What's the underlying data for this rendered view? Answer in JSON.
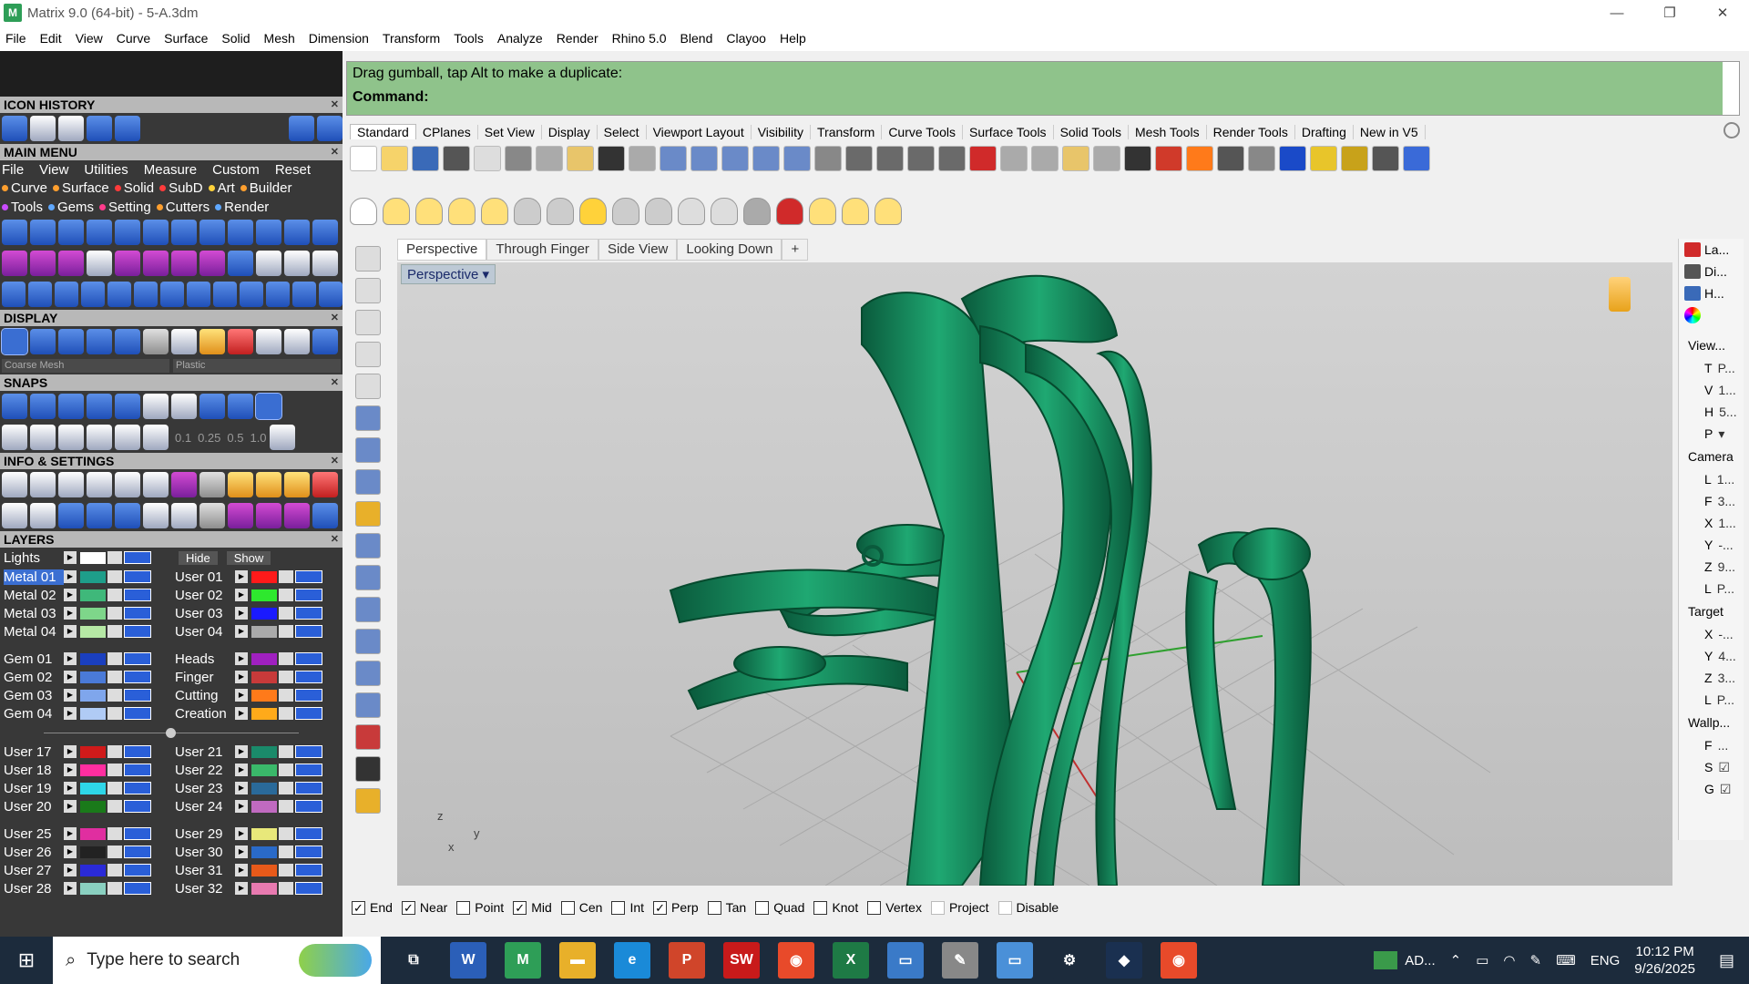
{
  "window": {
    "title": "Matrix 9.0 (64-bit) - 5-A.3dm",
    "logo": "M",
    "minimize": "—",
    "restore": "❐",
    "close": "✕"
  },
  "menu": [
    "File",
    "Edit",
    "View",
    "Curve",
    "Surface",
    "Solid",
    "Mesh",
    "Dimension",
    "Transform",
    "Tools",
    "Analyze",
    "Render",
    "Rhino 5.0",
    "Blend",
    "Clayoo",
    "Help"
  ],
  "left": {
    "icon_history": "ICON HISTORY",
    "main_menu": "MAIN MENU",
    "mm_items": [
      "File",
      "View",
      "Utilities",
      "Measure",
      "Custom",
      "Reset"
    ],
    "mm_cats": [
      {
        "label": "Curve",
        "color": "#ff9f2e"
      },
      {
        "label": "Surface",
        "color": "#ff9f2e"
      },
      {
        "label": "Solid",
        "color": "#ff3b3b"
      },
      {
        "label": "SubD",
        "color": "#ff3b3b"
      },
      {
        "label": "Art",
        "color": "#ffd23a"
      },
      {
        "label": "Builder",
        "color": "#ff9f2e"
      },
      {
        "label": "Tools",
        "color": "#c94bff"
      },
      {
        "label": "Gems",
        "color": "#5fa8ff"
      },
      {
        "label": "Setting",
        "color": "#ff3b8c"
      },
      {
        "label": "Cutters",
        "color": "#ff9f2e"
      },
      {
        "label": "Render",
        "color": "#5fa8ff"
      }
    ],
    "display": "DISPLAY",
    "display_mesh": "Coarse Mesh",
    "display_material": "Plastic",
    "snaps": "SNAPS",
    "snap_values": [
      "0.1",
      "0.25",
      "0.5",
      "1.0"
    ],
    "info_settings": "INFO & SETTINGS",
    "layers": "LAYERS",
    "lights": "Lights",
    "hide": "Hide",
    "show": "Show",
    "layers_left_1": [
      {
        "name": "Metal 01",
        "color": "#1e9e8a",
        "sel": true
      },
      {
        "name": "Metal 02",
        "color": "#3fb87a"
      },
      {
        "name": "Metal 03",
        "color": "#7ed68a"
      },
      {
        "name": "Metal 04",
        "color": "#b6e8a5"
      }
    ],
    "layers_right_1": [
      {
        "name": "User 01",
        "color": "#ff1a1a"
      },
      {
        "name": "User 02",
        "color": "#2ee82e"
      },
      {
        "name": "User 03",
        "color": "#1a1aff"
      },
      {
        "name": "User 04",
        "color": "#aaaaaa"
      }
    ],
    "layers_left_2": [
      {
        "name": "Gem 01",
        "color": "#1a3fbf"
      },
      {
        "name": "Gem 02",
        "color": "#4a7ad8"
      },
      {
        "name": "Gem 03",
        "color": "#7fa6ec"
      },
      {
        "name": "Gem 04",
        "color": "#b0cbf5"
      }
    ],
    "layers_right_2": [
      {
        "name": "Heads",
        "color": "#a020c0"
      },
      {
        "name": "Finger",
        "color": "#c83a3a"
      },
      {
        "name": "Cutting",
        "color": "#ff7a1a"
      },
      {
        "name": "Creation",
        "color": "#ffaa1a"
      }
    ],
    "layers_left_3": [
      {
        "name": "User 17",
        "color": "#d01a1a"
      },
      {
        "name": "User 18",
        "color": "#ff2ea0"
      },
      {
        "name": "User 19",
        "color": "#2ed6e8"
      },
      {
        "name": "User 20",
        "color": "#1a7a1a"
      }
    ],
    "layers_right_3": [
      {
        "name": "User 21",
        "color": "#1a8a6a"
      },
      {
        "name": "User 22",
        "color": "#3ab86a"
      },
      {
        "name": "User 23",
        "color": "#2a6a9a"
      },
      {
        "name": "User 24",
        "color": "#c06ac0"
      }
    ],
    "layers_left_4": [
      {
        "name": "User 25",
        "color": "#e02ea0"
      },
      {
        "name": "User 26",
        "color": "#222222"
      },
      {
        "name": "User 27",
        "color": "#2a2ad8"
      },
      {
        "name": "User 28",
        "color": "#8ad0c0"
      }
    ],
    "layers_right_4": [
      {
        "name": "User 29",
        "color": "#e8e87a"
      },
      {
        "name": "User 30",
        "color": "#2a6ac8"
      },
      {
        "name": "User 31",
        "color": "#e85a1a"
      },
      {
        "name": "User 32",
        "color": "#e87ab0"
      }
    ]
  },
  "command": {
    "prompt": "Drag gumball, tap Alt to make a duplicate:",
    "label": "Command:"
  },
  "toolbar_tabs": [
    "Standard",
    "CPlanes",
    "Set View",
    "Display",
    "Select",
    "Viewport Layout",
    "Visibility",
    "Transform",
    "Curve Tools",
    "Surface Tools",
    "Solid Tools",
    "Mesh Tools",
    "Render Tools",
    "Drafting",
    "New in V5"
  ],
  "viewport_tabs": [
    "Perspective",
    "Through Finger",
    "Side View",
    "Looking Down"
  ],
  "viewport_add": "+",
  "viewport_label": "Perspective",
  "viewport_dropdown": "▾",
  "axis": {
    "z": "z",
    "y": "y",
    "x": "x"
  },
  "right_panel": {
    "tabs": [
      "La...",
      "Di...",
      "H..."
    ],
    "view": "View...",
    "view_rows": [
      {
        "k": "T",
        "v": "P..."
      },
      {
        "k": "V",
        "v": "1..."
      },
      {
        "k": "H",
        "v": "5..."
      },
      {
        "k": "P",
        "v": "▾"
      }
    ],
    "camera": "Camera",
    "camera_rows": [
      {
        "k": "L",
        "v": "1..."
      },
      {
        "k": "F",
        "v": "3..."
      },
      {
        "k": "X",
        "v": "1..."
      },
      {
        "k": "Y",
        "v": "-..."
      },
      {
        "k": "Z",
        "v": "9..."
      },
      {
        "k": "L",
        "v": "P..."
      }
    ],
    "target": "Target",
    "target_rows": [
      {
        "k": "X",
        "v": "-..."
      },
      {
        "k": "Y",
        "v": "4..."
      },
      {
        "k": "Z",
        "v": "3..."
      },
      {
        "k": "L",
        "v": "P..."
      }
    ],
    "wallpaper": "Wallp...",
    "wall_rows": [
      {
        "k": "F",
        "v": "..."
      },
      {
        "k": "S",
        "v": "☑"
      },
      {
        "k": "G",
        "v": "☑"
      }
    ]
  },
  "osnaps": [
    {
      "label": "End",
      "checked": true
    },
    {
      "label": "Near",
      "checked": true
    },
    {
      "label": "Point",
      "checked": false
    },
    {
      "label": "Mid",
      "checked": true
    },
    {
      "label": "Cen",
      "checked": false
    },
    {
      "label": "Int",
      "checked": false
    },
    {
      "label": "Perp",
      "checked": true
    },
    {
      "label": "Tan",
      "checked": false
    },
    {
      "label": "Quad",
      "checked": false
    },
    {
      "label": "Knot",
      "checked": false
    },
    {
      "label": "Vertex",
      "checked": false
    },
    {
      "label": "Project",
      "checked": false,
      "disabled": true
    },
    {
      "label": "Disable",
      "checked": false,
      "disabled": true
    }
  ],
  "taskbar": {
    "search_placeholder": "Type here to search",
    "apps": [
      {
        "name": "task-view",
        "glyph": "⧉",
        "color": "#1c2b3c"
      },
      {
        "name": "word",
        "glyph": "W",
        "color": "#2b5fb8"
      },
      {
        "name": "matrix",
        "glyph": "M",
        "color": "#2e9e57"
      },
      {
        "name": "file-explorer",
        "glyph": "▬",
        "color": "#e8b02a"
      },
      {
        "name": "edge",
        "glyph": "e",
        "color": "#1a8ad8"
      },
      {
        "name": "powerpoint",
        "glyph": "P",
        "color": "#d0452a"
      },
      {
        "name": "solidworks",
        "glyph": "SW",
        "color": "#c81a1a"
      },
      {
        "name": "chrome",
        "glyph": "◉",
        "color": "#e84a2a"
      },
      {
        "name": "excel",
        "glyph": "X",
        "color": "#1e7a45"
      },
      {
        "name": "remote-desktop",
        "glyph": "▭",
        "color": "#3a7ac8"
      },
      {
        "name": "tools",
        "glyph": "✎",
        "color": "#888888"
      },
      {
        "name": "monitor",
        "glyph": "▭",
        "color": "#4a90d8"
      },
      {
        "name": "settings",
        "glyph": "⚙",
        "color": "#1c2b3c"
      },
      {
        "name": "app-dark",
        "glyph": "◆",
        "color": "#1a3050"
      },
      {
        "name": "chrome-2",
        "glyph": "◉",
        "color": "#e84a2a"
      }
    ],
    "tray_app": "AD...",
    "lang": "ENG",
    "time": "10:12 PM",
    "date": "9/26/2025"
  }
}
